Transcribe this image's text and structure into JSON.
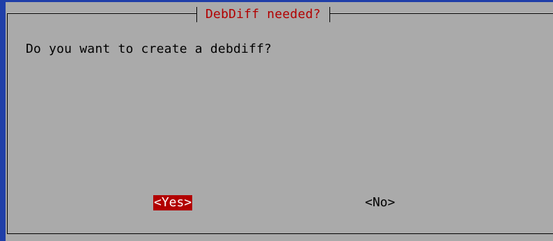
{
  "dialog": {
    "title": "DebDiff needed?",
    "message": "Do you want to create a debdiff?"
  },
  "buttons": {
    "yes_label": "<Yes>",
    "no_label": "<No>"
  },
  "colors": {
    "terminal_background": "#1f3ea8",
    "dialog_background": "#aaaaaa",
    "title_color": "#b20000",
    "selected_button_background": "#b20000",
    "selected_button_text": "#ffffff"
  }
}
